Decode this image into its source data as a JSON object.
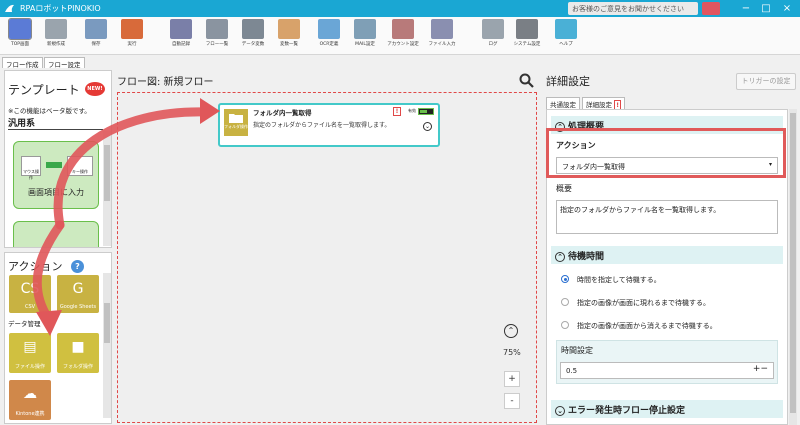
{
  "app": {
    "title": "RPAロボットPINOKIO",
    "feedback": "お客様のご意見をお聞かせください",
    "minimize": "−",
    "maximize": "□",
    "close": "×"
  },
  "toolbar": [
    {
      "label": "TOP画面",
      "name": "top-screen-button",
      "color": "#5b7bd6"
    },
    {
      "label": "新規作成",
      "name": "new-button",
      "color": "#9aa4ad"
    },
    {
      "label": "保存",
      "name": "save-button",
      "color": "#7a9abf"
    },
    {
      "label": "実行",
      "name": "run-button",
      "color": "#d86a3a"
    },
    {
      "label": "自動記録",
      "name": "auto-record-button",
      "color": "#7a7fa8"
    },
    {
      "label": "フロー一覧",
      "name": "flow-list-button",
      "color": "#8a94a0"
    },
    {
      "label": "データ変数",
      "name": "data-variable-button",
      "color": "#7d8893"
    },
    {
      "label": "変数一覧",
      "name": "variable-list-button",
      "color": "#d8a26a"
    },
    {
      "label": "OCR定義",
      "name": "ocr-button",
      "color": "#6aa6d6"
    },
    {
      "label": "MAIL設定",
      "name": "mail-button",
      "color": "#7f9fb6"
    },
    {
      "label": "アカウント設定",
      "name": "account-button",
      "color": "#b87a7a"
    },
    {
      "label": "ファイル入力",
      "name": "file-input-button",
      "color": "#8a8fb0"
    },
    {
      "label": "ログ",
      "name": "log-button",
      "color": "#9aa4ad"
    },
    {
      "label": "システム設定",
      "name": "system-settings-button",
      "color": "#7a7f85"
    },
    {
      "label": "ヘルプ",
      "name": "help-button",
      "color": "#4ab0d6"
    }
  ],
  "left_tabs": {
    "flow_create": "フロー作成",
    "flow_settings": "フロー設定"
  },
  "template": {
    "title": "テンプレート",
    "new_badge": "NEW!",
    "beta_note": "※この機能はベータ版です。",
    "category": "汎用系",
    "card_label": "画面項目に入力",
    "mouse_label": "マウス操作",
    "key_label": "キー操作"
  },
  "actions": {
    "title": "アクション",
    "help": "?",
    "cards": [
      {
        "label": "CSV",
        "glyph": "CS",
        "color": "#c8b242"
      },
      {
        "label": "Google Sheets",
        "glyph": "G",
        "color": "#c8b242"
      },
      {
        "label": "ファイル操作",
        "glyph": "▤",
        "color": "#d0c040"
      },
      {
        "label": "フォルダ操作",
        "glyph": "■",
        "color": "#d0c040"
      },
      {
        "label": "Kintone連携",
        "glyph": "☁",
        "color": "#d0884a"
      }
    ],
    "category_data": "データ管理"
  },
  "flow": {
    "title": "フロー図: 新規フロー",
    "zoom": "75%",
    "zoom_in": "+",
    "zoom_out": "-",
    "node": {
      "title": "フォルダ内一覧取得",
      "description": "指定のフォルダからファイル名を一覧取得します。",
      "enabled_label": "有効",
      "icon_label": "フォルダ操作",
      "warning": "!"
    }
  },
  "detail": {
    "title": "詳細設定",
    "trigger_button": "トリガーの設定",
    "tabs": {
      "common": "共通設定",
      "detail": "詳細設定",
      "warning": "!"
    },
    "processing": {
      "header": "処理概要",
      "action_label": "アクション",
      "action_value": "フォルダ内一覧取得",
      "summary_label": "概要",
      "summary_value": "指定のフォルダからファイル名を一覧取得します。"
    },
    "wait": {
      "header": "待機時間",
      "options": [
        "時間を指定して待機する。",
        "指定の画像が画面に現れるまで待機する。",
        "指定の画像が画面から消えるまで待機する。"
      ],
      "selected_index": 0,
      "time_label": "時間設定",
      "time_value": "0.5"
    },
    "error": {
      "header": "エラー発生時フロー停止設定"
    }
  },
  "colors": {
    "titlebar": "#1aa7d3",
    "accent_red": "#e05a5a",
    "node_border": "#43c9c9",
    "section_bg": "#def2f3"
  }
}
